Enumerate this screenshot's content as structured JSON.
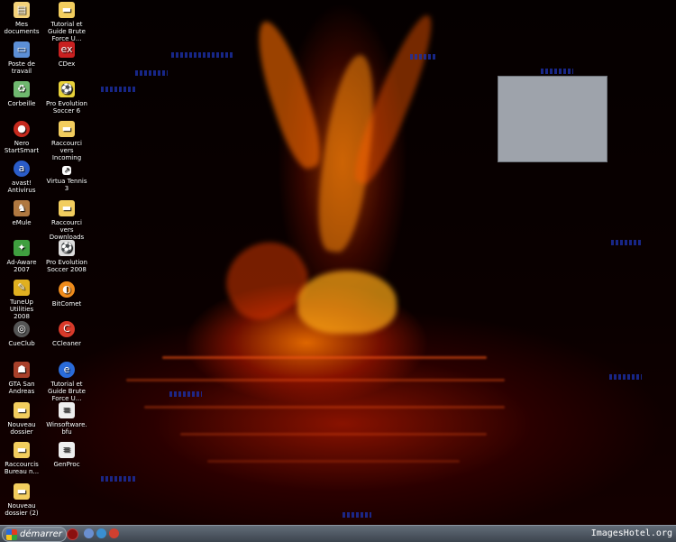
{
  "desktop_icons": [
    {
      "label": "Mes documents"
    },
    {
      "label": "Tutorial et Guide Brute Force U..."
    },
    {
      "label": "Poste de travail"
    },
    {
      "label": "CDex"
    },
    {
      "label": "Corbeille"
    },
    {
      "label": "Pro Evolution Soccer 6"
    },
    {
      "label": "Nero StartSmart"
    },
    {
      "label": "Raccourci vers Incoming"
    },
    {
      "label": "avast! Antivirus"
    },
    {
      "label": "Virtua Tennis 3"
    },
    {
      "label": "eMule"
    },
    {
      "label": "Raccourci vers Downloads"
    },
    {
      "label": "Ad-Aware 2007"
    },
    {
      "label": "Pro Evolution Soccer 2008"
    },
    {
      "label": "TuneUp Utilities 2008"
    },
    {
      "label": "BitComet"
    },
    {
      "label": "CueClub"
    },
    {
      "label": "CCleaner"
    },
    {
      "label": "GTA San Andreas"
    },
    {
      "label": "Tutorial et Guide Brute Force U..."
    },
    {
      "label": "Nouveau dossier"
    },
    {
      "label": "Winsoftware.bfu"
    },
    {
      "label": "Raccourcis Bureau n..."
    },
    {
      "label": "GenProc"
    },
    {
      "label": "Nouveau dossier (2)"
    }
  ],
  "taskbar": {
    "start_label": "démarrer",
    "watermark": "ImagesHotel.org"
  }
}
